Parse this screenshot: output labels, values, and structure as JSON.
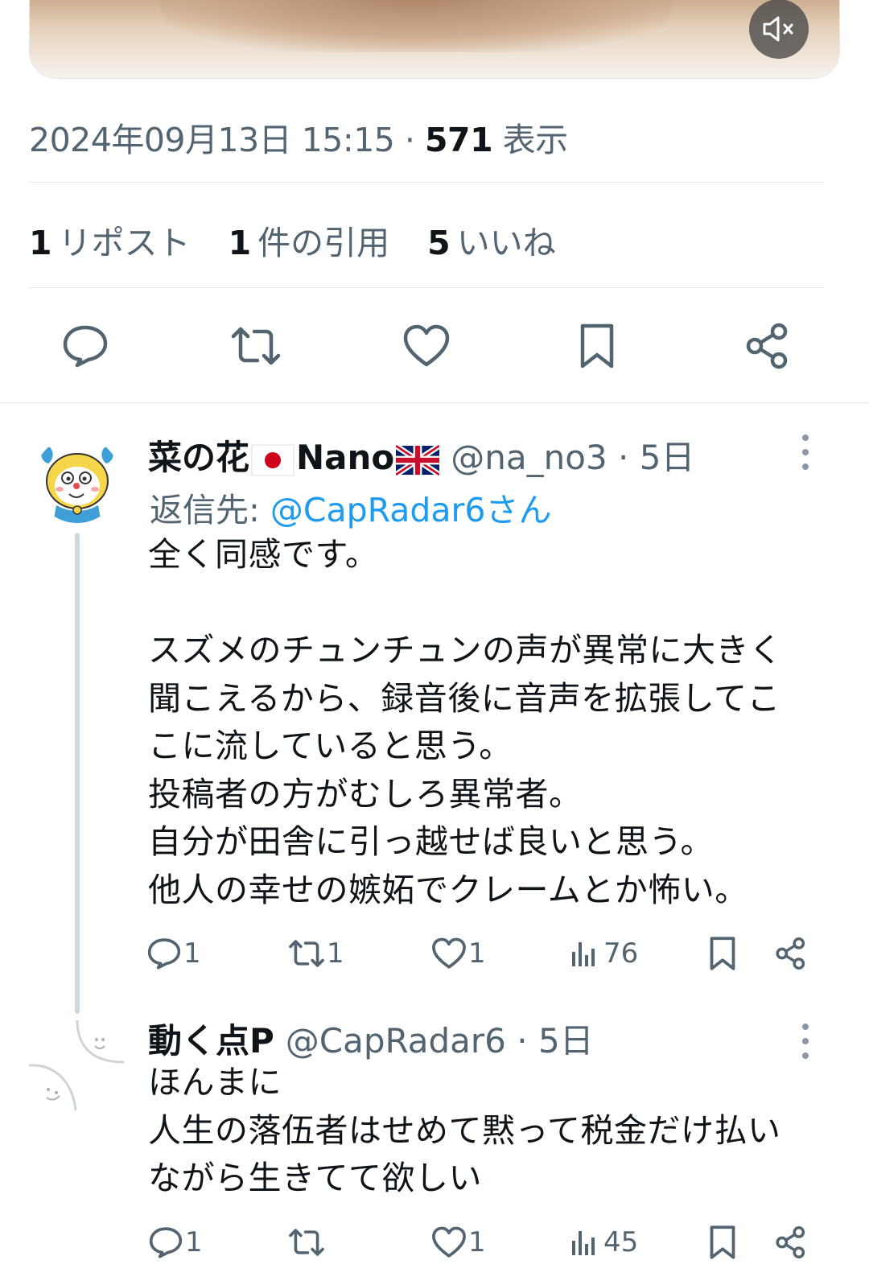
{
  "media": {
    "mute_icon": "speaker-muted-icon"
  },
  "post": {
    "timestamp": "2024年09月13日 15:15",
    "separator": "·",
    "views_count": "571",
    "views_label": "表示",
    "stats": [
      {
        "count": "1",
        "label": "リポスト"
      },
      {
        "count": "1",
        "label": "件の引用"
      },
      {
        "count": "5",
        "label": "いいね"
      }
    ],
    "actions": [
      "reply-icon",
      "repost-icon",
      "like-icon",
      "bookmark-icon",
      "share-icon"
    ]
  },
  "replies": [
    {
      "display_name": "菜の花",
      "display_name_suffix": "Nano",
      "flags": [
        "flag-japan-icon",
        "flag-uk-icon"
      ],
      "handle": "@na_no3",
      "time": "5日",
      "reply_to_prefix": "返信先: ",
      "reply_to_handle": "@CapRadar6さん",
      "text": "全く同感です。\n\nスズメのチュンチュンの声が異常に大きく\n聞こえるから、録音後に音声を拡張してこ\nこに流していると思う。\n投稿者の方がむしろ異常者。\n自分が田舎に引っ越せば良いと思う。\n他人の幸せの嫉妬でクレームとか怖い。",
      "reply_count": "1",
      "repost_count": "1",
      "like_count": "1",
      "view_count": "76"
    },
    {
      "display_name": "動く点P",
      "handle": "@CapRadar6",
      "time": "5日",
      "text": "ほんまに\n人生の落伍者はせめて黙って税金だけ払い\nながら生きてて欲しい",
      "reply_count": "1",
      "repost_count": "",
      "like_count": "1",
      "view_count": "45"
    }
  ]
}
